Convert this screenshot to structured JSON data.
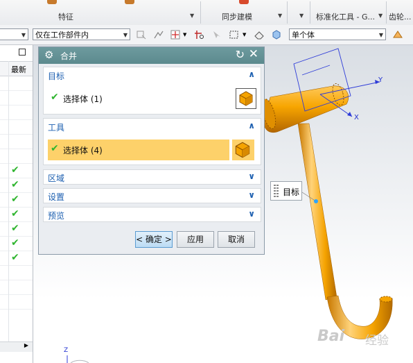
{
  "ribbon": {
    "groups": [
      "特征",
      "同步建模",
      "标准化工具 - G...",
      "齿轮..."
    ]
  },
  "toolbar": {
    "scope_select": "仅在工作部件内",
    "body_filter": "单个体"
  },
  "navigator": {
    "column_latest": "最新",
    "row_count": 16,
    "checked_rows": [
      6,
      7,
      8,
      9,
      10,
      11,
      12
    ]
  },
  "dialog": {
    "title": "合并",
    "sections": {
      "target": {
        "label": "目标",
        "select_label": "选择体 (1)"
      },
      "tool": {
        "label": "工具",
        "select_label": "选择体 (4)"
      },
      "region": {
        "label": "区域"
      },
      "settings": {
        "label": "设置"
      },
      "preview": {
        "label": "预览"
      }
    },
    "buttons": {
      "ok": "< 确定 >",
      "apply": "应用",
      "cancel": "取消"
    }
  },
  "viewport": {
    "tag_label": "目标",
    "axis_y": "Y",
    "axis_x": "X",
    "axis_z": "Z",
    "watermark": "Bai",
    "watermark_suffix": "经验"
  },
  "colors": {
    "part": "#f5a300",
    "dialog_title": "#5f8f93",
    "section_label": "#1c5fb0",
    "check": "#2fb52f",
    "tool_highlight": "#fdd16a"
  }
}
